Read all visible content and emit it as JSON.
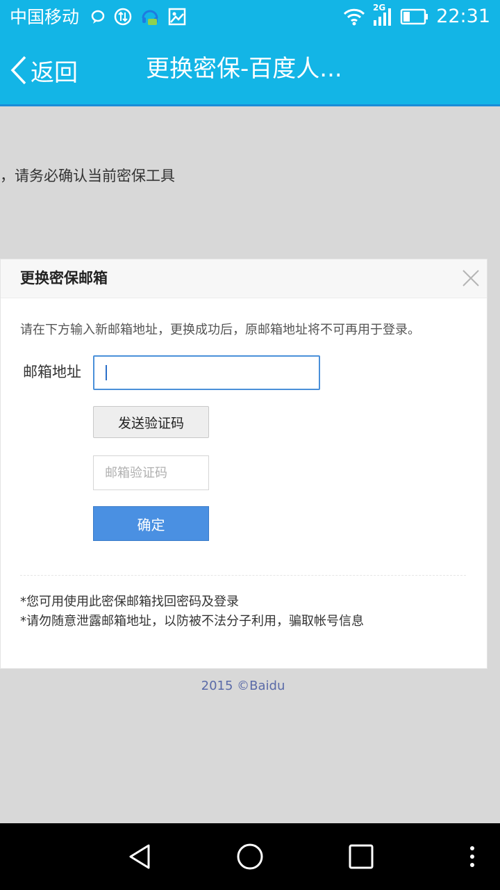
{
  "status_bar": {
    "carrier": "中国移动",
    "network": "2G",
    "time": "22:31",
    "icons": [
      "chat-icon",
      "data-sync-icon",
      "headset-icon",
      "image-icon",
      "wifi-icon",
      "signal-icon",
      "battery-icon"
    ]
  },
  "header": {
    "back_label": "返回",
    "title": "更换密保-百度人..."
  },
  "background": {
    "notice_text": "，请务必确认当前密保工具"
  },
  "dialog": {
    "title": "更换密保邮箱",
    "description": "请在下方输入新邮箱地址，更换成功后，原邮箱地址将不可再用于登录。",
    "email_label": "邮箱地址",
    "email_value": "",
    "send_code_label": "发送验证码",
    "code_placeholder": "邮箱验证码",
    "confirm_label": "确定",
    "notes": [
      "*您可用使用此密保邮箱找回密码及登录",
      "*请勿随意泄露邮箱地址，以防被不法分子利用，骗取帐号信息"
    ]
  },
  "footer": {
    "copyright": "2015 ©Baidu"
  },
  "colors": {
    "header_bg": "#13b5e6",
    "primary_button": "#4a90e2",
    "input_focus": "#4a90d9"
  }
}
